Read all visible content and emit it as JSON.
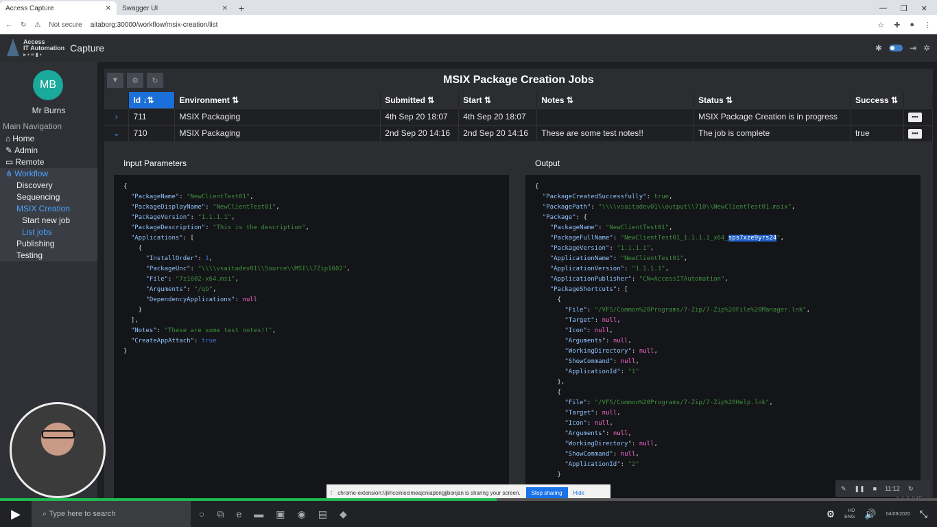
{
  "browser": {
    "tabs": [
      {
        "title": "Access Capture",
        "active": true
      },
      {
        "title": "Swagger UI",
        "active": false
      }
    ],
    "security": "Not secure",
    "url": "aitaborg:30000/workflow/msix-creation/list"
  },
  "app": {
    "brand_line1": "Access",
    "brand_line2": "IT Automation",
    "title": "Capture"
  },
  "user": {
    "initials": "MB",
    "name": "Mr Burns"
  },
  "nav": {
    "title": "Main Navigation",
    "home": "Home",
    "admin": "Admin",
    "remote": "Remote",
    "workflow": "Workflow",
    "discovery": "Discovery",
    "sequencing": "Sequencing",
    "msix": "MSIX Creation",
    "start_new": "Start new job",
    "list_jobs": "List jobs",
    "publishing": "Publishing",
    "testing": "Testing"
  },
  "page": {
    "title": "MSIX Package Creation Jobs"
  },
  "table": {
    "headers": {
      "id": "Id",
      "environment": "Environment",
      "submitted": "Submitted",
      "start": "Start",
      "notes": "Notes",
      "status": "Status",
      "success": "Success"
    },
    "rows": [
      {
        "id": "711",
        "environment": "MSIX Packaging",
        "submitted": "4th Sep 20 18:07",
        "start": "4th Sep 20 18:07",
        "notes": "",
        "status": "MSIX Package Creation is in progress",
        "success": ""
      },
      {
        "id": "710",
        "environment": "MSIX Packaging",
        "submitted": "2nd Sep 20 14:16",
        "start": "2nd Sep 20 14:16",
        "notes": "These are some test notes!!",
        "status": "The job is complete",
        "success": "true"
      }
    ]
  },
  "input_panel": {
    "title": "Input Parameters"
  },
  "output_panel": {
    "title": "Output"
  },
  "share": {
    "text": "chrome-extension://jiihcciniecimeajcniapbngjjbonjan is sharing your screen.",
    "stop": "Stop sharing",
    "hide": "Hide"
  },
  "player": {
    "time": "11:12",
    "progress_fraction": 0.53
  },
  "taskbar": {
    "search": "Type here to search",
    "lang": "ENG",
    "hd": "HD",
    "date": "04/09/2020"
  },
  "version": "3.1.3-945"
}
